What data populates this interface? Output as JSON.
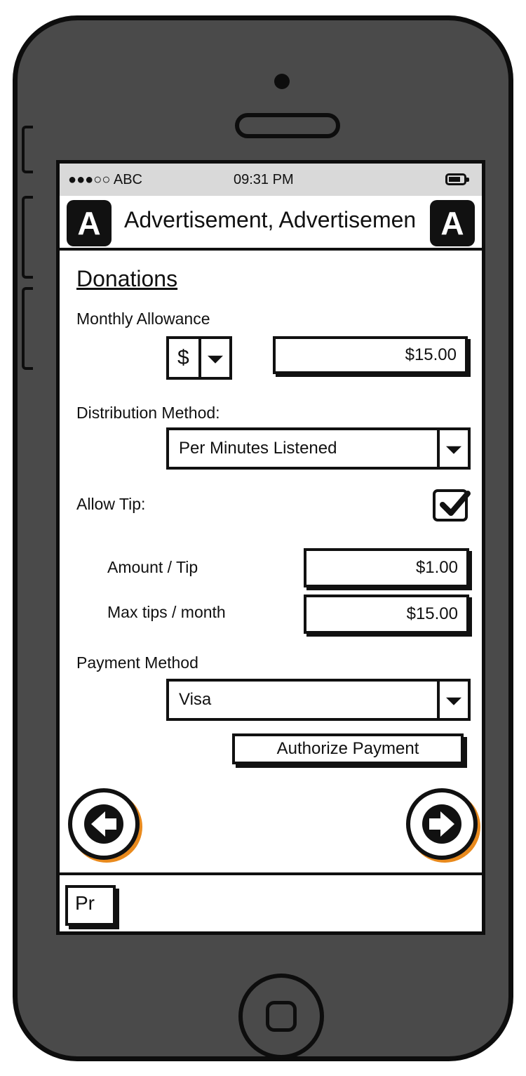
{
  "status_bar": {
    "carrier": "●●●○○ ABC",
    "time": "09:31 PM"
  },
  "ad_bar": {
    "logo_letter": "A",
    "text": "Advertisement, Advertisement"
  },
  "page": {
    "title": "Donations"
  },
  "monthly_allowance": {
    "label": "Monthly Allowance",
    "currency": "$",
    "amount": "$15.00"
  },
  "distribution": {
    "label": "Distribution Method:",
    "selected": "Per Minutes Listened"
  },
  "tip": {
    "label": "Allow Tip:",
    "checked": true,
    "amount_label": "Amount / Tip",
    "amount_value": "$1.00",
    "max_label": "Max tips / month",
    "max_value": "$15.00"
  },
  "payment": {
    "label": "Payment Method",
    "selected": "Visa",
    "authorize_label": "Authorize Payment"
  },
  "footer": {
    "tab_label": "Pr"
  },
  "colors": {
    "shadow_accent": "#e98a1d",
    "phone_body": "#4a4a4a",
    "status_bg": "#d9d9d9"
  },
  "icons": [
    "back-arrow-icon",
    "forward-arrow-icon",
    "checkmark-icon",
    "dropdown-caret-icon",
    "battery-icon"
  ]
}
